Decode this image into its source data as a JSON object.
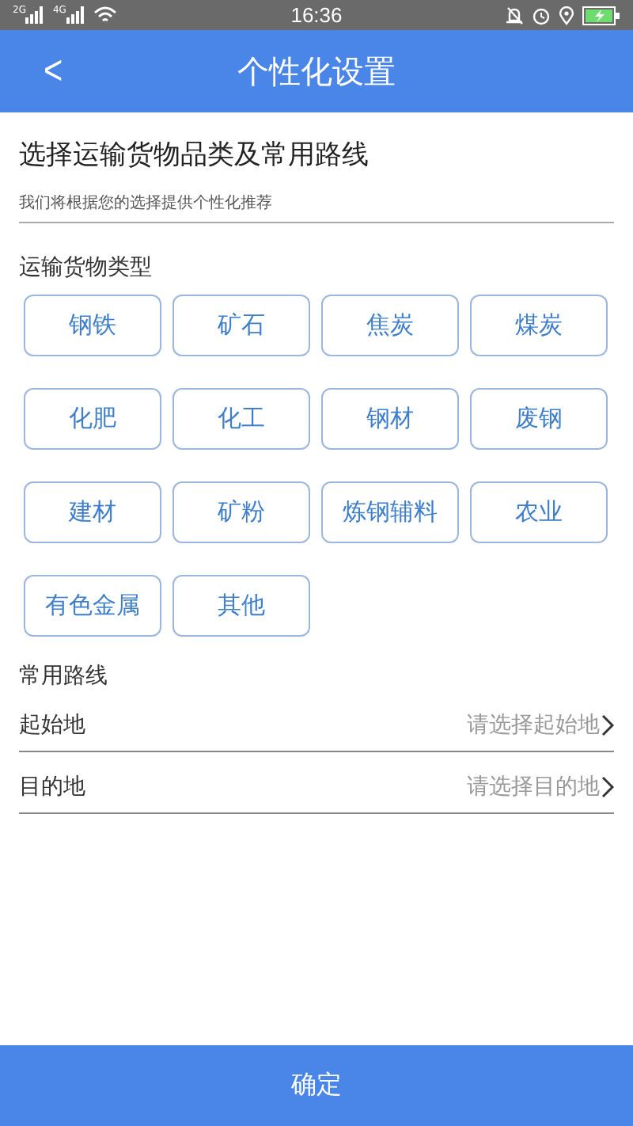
{
  "status_bar": {
    "network_1": "2G",
    "network_2": "4G",
    "time": "16:36"
  },
  "header": {
    "back": "<",
    "title": "个性化设置"
  },
  "intro": {
    "heading": "选择运输货物品类及常用路线",
    "subtitle": "我们将根据您的选择提供个性化推荐"
  },
  "cargo_types": {
    "label": "运输货物类型",
    "options": [
      "钢铁",
      "矿石",
      "焦炭",
      "煤炭",
      "化肥",
      "化工",
      "钢材",
      "废钢",
      "建材",
      "矿粉",
      "炼钢辅料",
      "农业",
      "有色金属",
      "其他"
    ]
  },
  "routes": {
    "label": "常用路线",
    "fields": [
      {
        "label": "起始地",
        "placeholder": "请选择起始地"
      },
      {
        "label": "目的地",
        "placeholder": "请选择目的地"
      }
    ]
  },
  "confirm_button": "确定"
}
